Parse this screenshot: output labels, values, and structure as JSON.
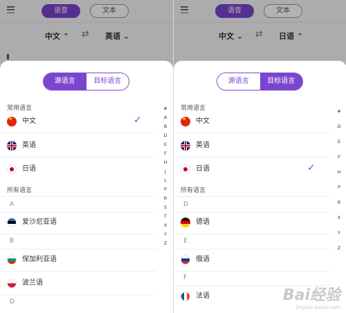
{
  "left": {
    "app": {
      "mode_tabs": [
        "语音",
        "文本"
      ],
      "source_lang": "中文",
      "source_arrow": "⌃",
      "target_lang": "英语",
      "target_arrow": "⌄",
      "swap": "⇄"
    },
    "segment": {
      "options": [
        "源语言",
        "目标语言"
      ],
      "selected": "源语言"
    },
    "common_title": "常用语言",
    "common": [
      {
        "name": "中文",
        "flag": "cn",
        "checked": true
      },
      {
        "name": "英语",
        "flag": "uk",
        "checked": false
      },
      {
        "name": "日语",
        "flag": "jp",
        "checked": false
      }
    ],
    "all_title": "所有语言",
    "groups": [
      {
        "letter": "A",
        "items": [
          {
            "name": "爱沙尼亚语",
            "flag": "ee"
          }
        ]
      },
      {
        "letter": "B",
        "items": [
          {
            "name": "保加利亚语",
            "flag": "bg"
          },
          {
            "name": "波兰语",
            "flag": "pl"
          }
        ]
      },
      {
        "letter": "D",
        "items": []
      }
    ],
    "index": [
      "#",
      "A",
      "B",
      "D",
      "E",
      "F",
      "H",
      "J",
      "L",
      "P",
      "R",
      "S",
      "T",
      "X",
      "Y",
      "Z"
    ]
  },
  "right": {
    "app": {
      "mode_tabs": [
        "语音",
        "文本"
      ],
      "source_lang": "中文",
      "source_arrow": "⌄",
      "target_lang": "日语",
      "target_arrow": "⌃",
      "swap": "⇄"
    },
    "segment": {
      "options": [
        "源语言",
        "目标语言"
      ],
      "selected": "目标语言"
    },
    "common_title": "常用语言",
    "common": [
      {
        "name": "中文",
        "flag": "cn",
        "checked": false
      },
      {
        "name": "英语",
        "flag": "uk",
        "checked": false
      },
      {
        "name": "日语",
        "flag": "jp",
        "checked": true
      }
    ],
    "all_title": "所有语言",
    "groups": [
      {
        "letter": "D",
        "items": [
          {
            "name": "德语",
            "flag": "de"
          }
        ]
      },
      {
        "letter": "E",
        "items": [
          {
            "name": "俄语",
            "flag": "ru"
          }
        ]
      },
      {
        "letter": "F",
        "items": [
          {
            "name": "法语",
            "flag": "fr"
          }
        ]
      }
    ],
    "index": [
      "#",
      "D",
      "E",
      "F",
      "H",
      "P",
      "R",
      "X",
      "Y",
      "Z"
    ]
  },
  "check_mark": "✓",
  "watermark": {
    "brand": "Bai经验",
    "url": "jingyan.baidu.com"
  },
  "colors": {
    "accent": "#7b46cf",
    "dim_overlay": "rgba(0,0,0,0.30)"
  }
}
